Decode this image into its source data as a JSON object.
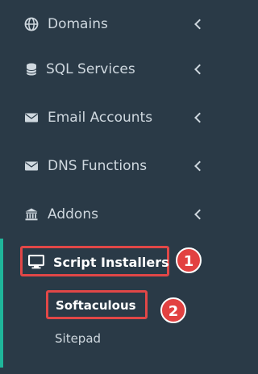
{
  "menu": {
    "items": [
      {
        "label": "Domains",
        "icon": "globe-icon",
        "has_chevron": true
      },
      {
        "label": "SQL Services",
        "icon": "database-icon",
        "has_chevron": true
      },
      {
        "label": "Email Accounts",
        "icon": "envelope-icon",
        "has_chevron": true
      },
      {
        "label": "DNS Functions",
        "icon": "envelope-icon",
        "has_chevron": true
      },
      {
        "label": "Addons",
        "icon": "bank-icon",
        "has_chevron": true
      }
    ],
    "active": {
      "label": "Script Installers",
      "icon": "monitor-icon",
      "badge": "1",
      "subitems": [
        {
          "label": "Softaculous",
          "badge": "2"
        },
        {
          "label": "Sitepad"
        }
      ]
    }
  },
  "colors": {
    "background": "#2a3a47",
    "accent_bar": "#1fb59a",
    "highlight": "#e14747",
    "text": "#cfd8df"
  }
}
